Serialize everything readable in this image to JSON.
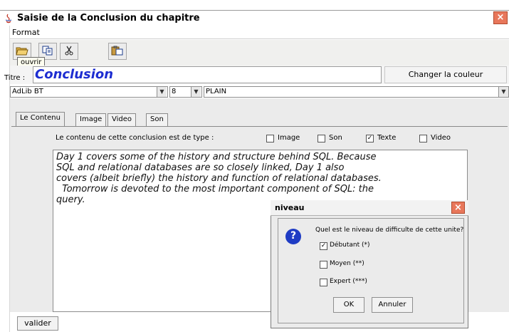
{
  "window": {
    "title": "Saisie de la Conclusion du chapitre",
    "close_glyph": "×"
  },
  "menu": {
    "format": "Format"
  },
  "toolbar": {
    "tooltip": "ouvrir",
    "buttons": [
      "open-icon",
      "copy-icon",
      "cut-icon",
      "paste-icon"
    ]
  },
  "title_row": {
    "label": "Titre :",
    "value": "Conclusion",
    "color_button": "Changer la couleur"
  },
  "font_row": {
    "font": "AdLib BT",
    "size": "8",
    "style": "PLAIN",
    "arrow": "▼"
  },
  "tabs": [
    "Le Contenu",
    "Image",
    "Video",
    "Son"
  ],
  "content": {
    "type_label": "Le contenu de cette conclusion est de type :",
    "types": [
      {
        "label": "Image",
        "checked": false
      },
      {
        "label": "Son",
        "checked": false
      },
      {
        "label": "Texte",
        "checked": true
      },
      {
        "label": "Video",
        "checked": false
      }
    ],
    "text": "Day 1 covers some of the history and structure behind SQL. Because\nSQL and relational databases are so closely linked, Day 1 also\ncovers (albeit briefly) the history and function of relational databases.\n  Tomorrow is devoted to the most important component of SQL: the\nquery."
  },
  "valider": "valider",
  "dialog": {
    "title": "niveau",
    "close_glyph": "×",
    "icon_glyph": "?",
    "question": "Quel est le niveau de difficulte de cette unite?",
    "options": [
      {
        "label": "Débutant (*)",
        "checked": true
      },
      {
        "label": "Moyen (**)",
        "checked": false
      },
      {
        "label": "Expert (***)",
        "checked": false
      }
    ],
    "ok": "OK",
    "cancel": "Annuler",
    "check_glyph": "✓"
  },
  "colors": {
    "title_blue": "#1d2dd1",
    "close_red": "#e8775b",
    "question_blue": "#1f3cc4"
  }
}
